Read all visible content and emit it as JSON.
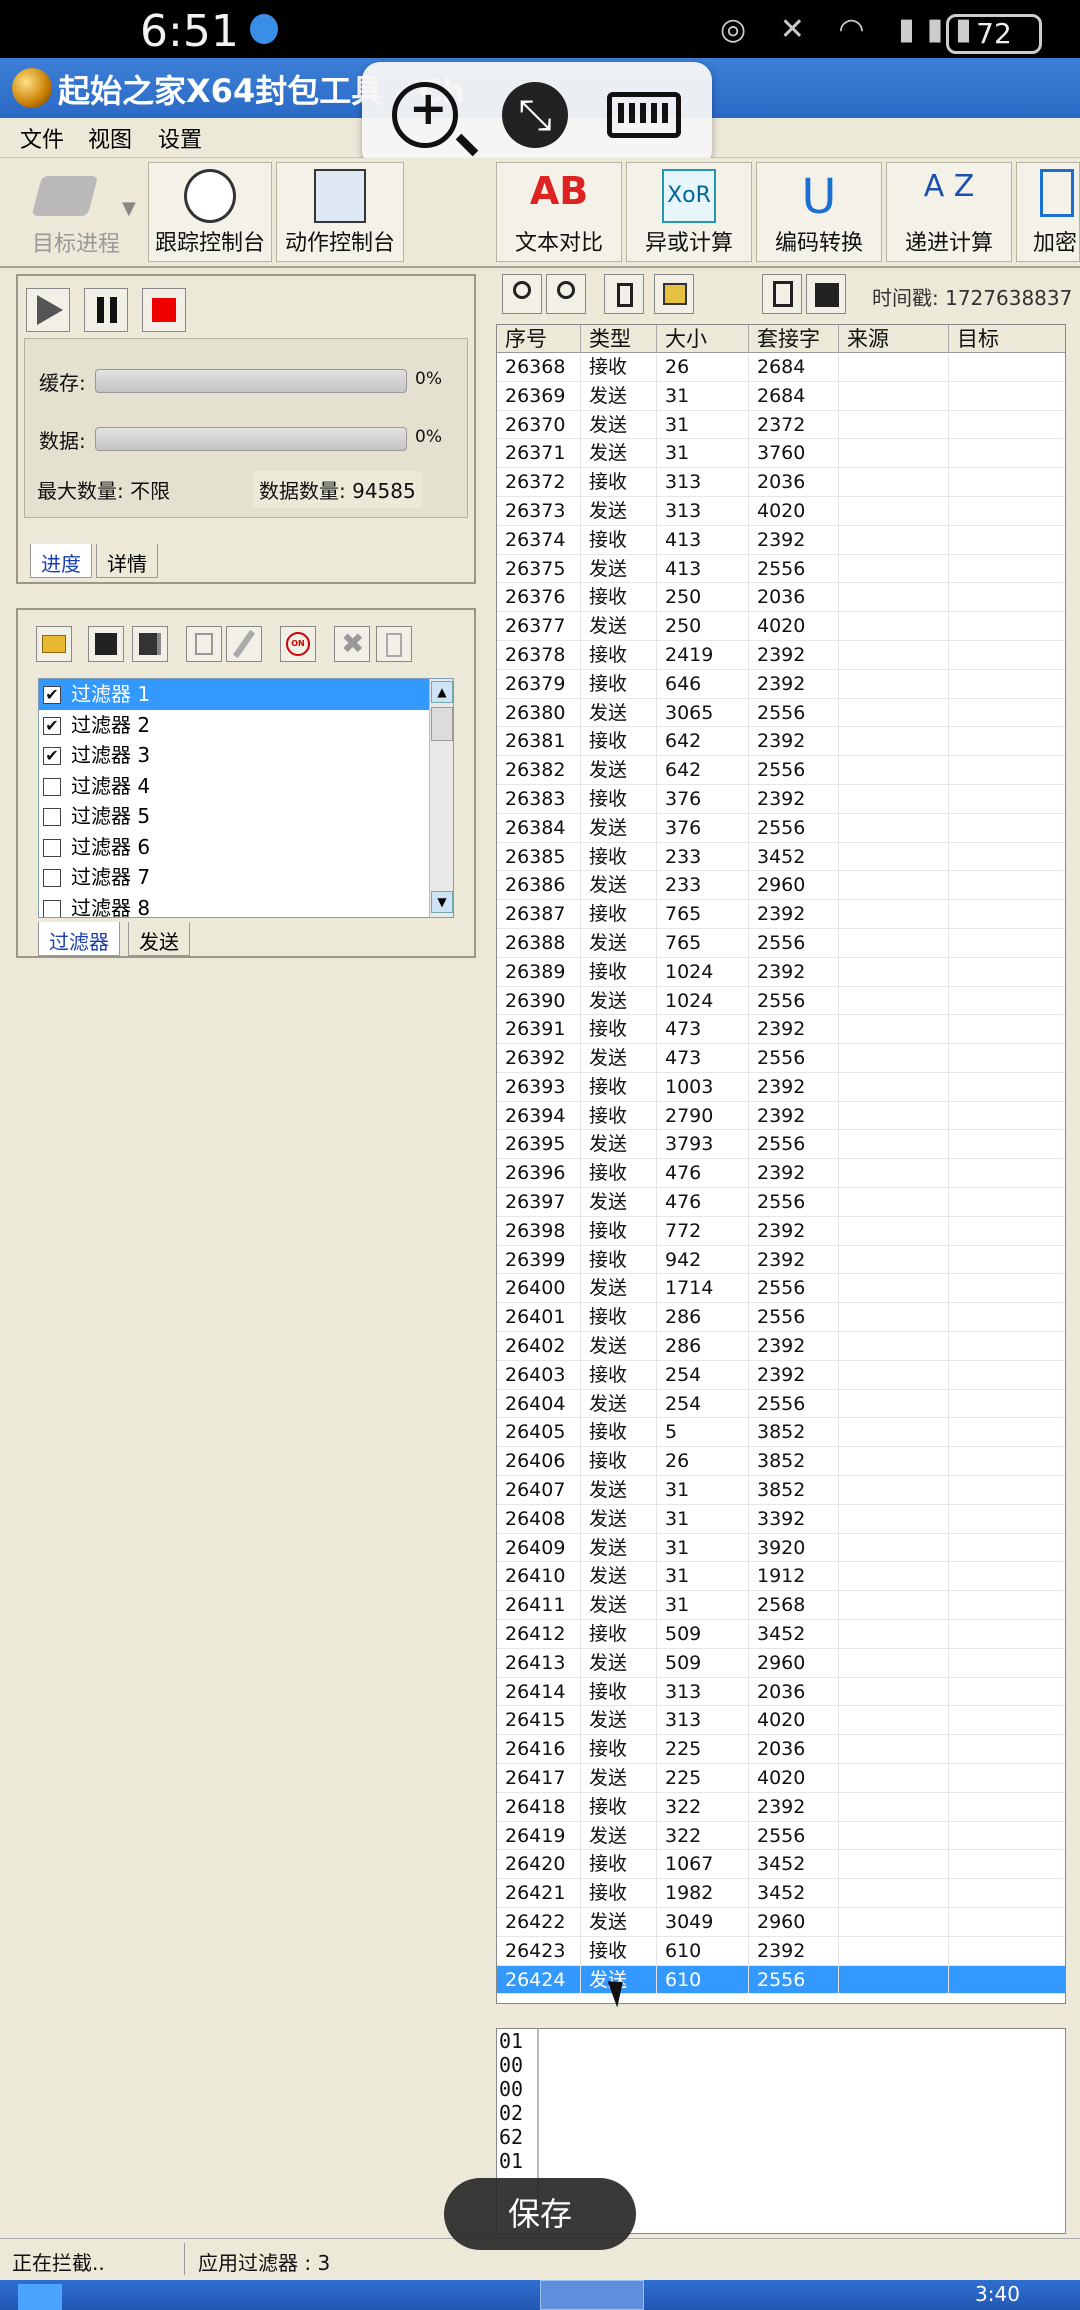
{
  "phone": {
    "time": "6:51",
    "battery": "72"
  },
  "window": {
    "title": "起始之家X64封包工具 - Ch"
  },
  "menu": [
    "文件",
    "视图",
    "设置"
  ],
  "toolbar_left": [
    {
      "label": "目标进程",
      "icon": "chip-icon",
      "disabled": true
    },
    {
      "label": "跟踪控制台",
      "icon": "trace-console-icon"
    },
    {
      "label": "动作控制台",
      "icon": "action-console-icon"
    }
  ],
  "toolbar_right": [
    {
      "label": "文本对比",
      "icon": "text-compare-icon",
      "glyph": "AB"
    },
    {
      "label": "异或计算",
      "icon": "xor-icon",
      "glyph": "XoR"
    },
    {
      "label": "编码转换",
      "icon": "encoding-icon",
      "glyph": "U"
    },
    {
      "label": "递进计算",
      "icon": "az-icon",
      "glyph": "A Z"
    },
    {
      "label": "加密",
      "icon": "encrypt-icon",
      "glyph": ""
    }
  ],
  "progress_panel": {
    "cache_label": "缓存:",
    "cache_percent": "0%",
    "cache_fraction": 0,
    "data_label": "数据:",
    "data_percent": "0%",
    "data_fraction": 0,
    "max_label": "最大数量: 不限",
    "count_label": "数据数量: 94585",
    "tabs": [
      "进度",
      "详情"
    ]
  },
  "filter_panel": {
    "filters": [
      {
        "label": "过滤器 1",
        "checked": true,
        "selected": true
      },
      {
        "label": "过滤器 2",
        "checked": true
      },
      {
        "label": "过滤器 3",
        "checked": true
      },
      {
        "label": "过滤器 4",
        "checked": false
      },
      {
        "label": "过滤器 5",
        "checked": false
      },
      {
        "label": "过滤器 6",
        "checked": false
      },
      {
        "label": "过滤器 7",
        "checked": false
      },
      {
        "label": "过滤器 8",
        "checked": false
      }
    ],
    "tabs": [
      "过滤器",
      "发送"
    ],
    "on_badge": "ON"
  },
  "packet_toolbar": {
    "timestamp": "时间戳: 1727638837"
  },
  "packet_table": {
    "columns": [
      "序号",
      "类型",
      "大小",
      "套接字",
      "来源",
      "目标"
    ],
    "rows": [
      [
        "26368",
        "接收",
        "26",
        "2684"
      ],
      [
        "26369",
        "发送",
        "31",
        "2684"
      ],
      [
        "26370",
        "发送",
        "31",
        "2372"
      ],
      [
        "26371",
        "发送",
        "31",
        "3760"
      ],
      [
        "26372",
        "接收",
        "313",
        "2036"
      ],
      [
        "26373",
        "发送",
        "313",
        "4020"
      ],
      [
        "26374",
        "接收",
        "413",
        "2392"
      ],
      [
        "26375",
        "发送",
        "413",
        "2556"
      ],
      [
        "26376",
        "接收",
        "250",
        "2036"
      ],
      [
        "26377",
        "发送",
        "250",
        "4020"
      ],
      [
        "26378",
        "接收",
        "2419",
        "2392"
      ],
      [
        "26379",
        "接收",
        "646",
        "2392"
      ],
      [
        "26380",
        "发送",
        "3065",
        "2556"
      ],
      [
        "26381",
        "接收",
        "642",
        "2392"
      ],
      [
        "26382",
        "发送",
        "642",
        "2556"
      ],
      [
        "26383",
        "接收",
        "376",
        "2392"
      ],
      [
        "26384",
        "发送",
        "376",
        "2556"
      ],
      [
        "26385",
        "接收",
        "233",
        "3452"
      ],
      [
        "26386",
        "发送",
        "233",
        "2960"
      ],
      [
        "26387",
        "接收",
        "765",
        "2392"
      ],
      [
        "26388",
        "发送",
        "765",
        "2556"
      ],
      [
        "26389",
        "接收",
        "1024",
        "2392"
      ],
      [
        "26390",
        "发送",
        "1024",
        "2556"
      ],
      [
        "26391",
        "接收",
        "473",
        "2392"
      ],
      [
        "26392",
        "发送",
        "473",
        "2556"
      ],
      [
        "26393",
        "接收",
        "1003",
        "2392"
      ],
      [
        "26394",
        "接收",
        "2790",
        "2392"
      ],
      [
        "26395",
        "发送",
        "3793",
        "2556"
      ],
      [
        "26396",
        "接收",
        "476",
        "2392"
      ],
      [
        "26397",
        "发送",
        "476",
        "2556"
      ],
      [
        "26398",
        "接收",
        "772",
        "2392"
      ],
      [
        "26399",
        "接收",
        "942",
        "2392"
      ],
      [
        "26400",
        "发送",
        "1714",
        "2556"
      ],
      [
        "26401",
        "接收",
        "286",
        "2556"
      ],
      [
        "26402",
        "发送",
        "286",
        "2392"
      ],
      [
        "26403",
        "接收",
        "254",
        "2392"
      ],
      [
        "26404",
        "发送",
        "254",
        "2556"
      ],
      [
        "26405",
        "接收",
        "5",
        "3852"
      ],
      [
        "26406",
        "接收",
        "26",
        "3852"
      ],
      [
        "26407",
        "发送",
        "31",
        "3852"
      ],
      [
        "26408",
        "发送",
        "31",
        "3392"
      ],
      [
        "26409",
        "发送",
        "31",
        "3920"
      ],
      [
        "26410",
        "发送",
        "31",
        "1912"
      ],
      [
        "26411",
        "发送",
        "31",
        "2568"
      ],
      [
        "26412",
        "接收",
        "509",
        "3452"
      ],
      [
        "26413",
        "发送",
        "509",
        "2960"
      ],
      [
        "26414",
        "接收",
        "313",
        "2036"
      ],
      [
        "26415",
        "发送",
        "313",
        "4020"
      ],
      [
        "26416",
        "接收",
        "225",
        "2036"
      ],
      [
        "26417",
        "发送",
        "225",
        "4020"
      ],
      [
        "26418",
        "接收",
        "322",
        "2392"
      ],
      [
        "26419",
        "发送",
        "322",
        "2556"
      ],
      [
        "26420",
        "接收",
        "1067",
        "3452"
      ],
      [
        "26421",
        "接收",
        "1982",
        "3452"
      ],
      [
        "26422",
        "发送",
        "3049",
        "2960"
      ],
      [
        "26423",
        "接收",
        "610",
        "2392"
      ],
      [
        "26424",
        "发送",
        "610",
        "2556"
      ]
    ],
    "selected_index": 56
  },
  "hex_pane": {
    "lines": [
      "01",
      "00",
      "00",
      "02",
      "62",
      "01"
    ]
  },
  "status_bar": {
    "left": "正在拦截..",
    "filters": "应用过滤器 : 3",
    "clock": "3:40"
  },
  "toast": {
    "label": "保存"
  }
}
